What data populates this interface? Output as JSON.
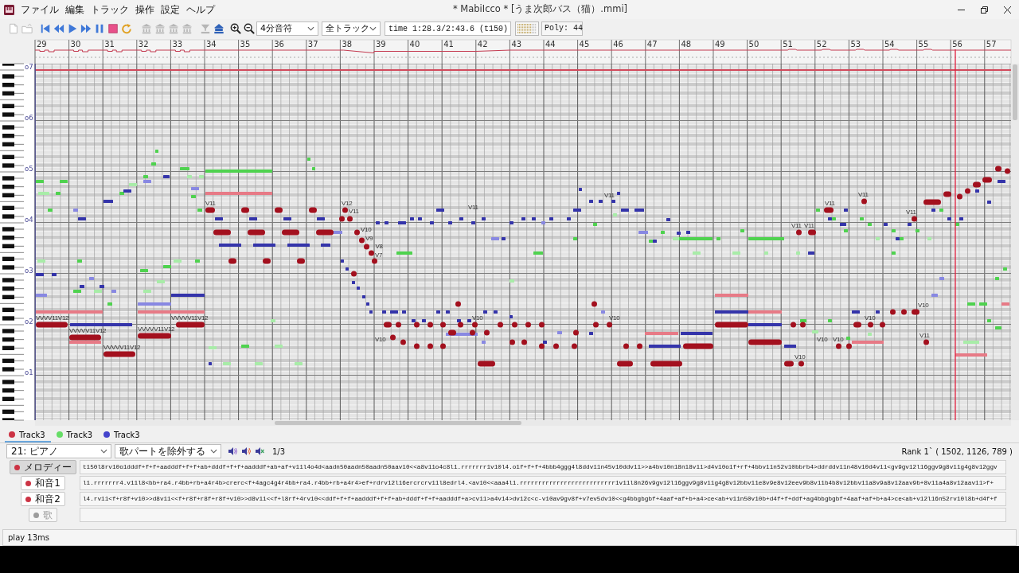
{
  "window": {
    "title": "* MabiIcco *  [うま次郎バス（猫）.mmi]"
  },
  "menu": [
    "ファイル",
    "編集",
    "トラック",
    "操作",
    "設定",
    "ヘルプ"
  ],
  "toolbar": {
    "buttons": [
      {
        "disabled": true
      },
      {
        "disabled": true
      },
      {
        "disabled": false
      },
      {
        "disabled": false
      },
      {
        "disabled": false
      },
      {
        "disabled": false
      },
      {
        "disabled": false
      },
      {
        "disabled": false
      },
      {
        "disabled": false
      },
      {
        "disabled": true
      },
      {
        "disabled": true
      },
      {
        "disabled": true
      },
      {
        "disabled": true
      },
      {
        "disabled": true
      },
      {
        "disabled": false
      },
      {
        "disabled": false
      },
      {
        "disabled": false
      }
    ],
    "note_length": "4分音符",
    "track_filter": "全トラック",
    "time": "time 1:28.3/2:43.6 (t150)",
    "poly": "Poly: 44"
  },
  "piano_roll": {
    "measures": [
      "29",
      "30",
      "31",
      "32",
      "33",
      "34",
      "35",
      "36",
      "37",
      "38",
      "39",
      "40",
      "41",
      "42",
      "43",
      "44",
      "45",
      "46",
      "47",
      "48",
      "49",
      "50",
      "51",
      "52",
      "53",
      "54",
      "55",
      "56",
      "57"
    ],
    "octaves": [
      "o7",
      "o6",
      "o5",
      "o4",
      "o3",
      "o2",
      "o1"
    ],
    "velocity_labels": [
      "VVVV11V12",
      "VVVVV11V12",
      "VVVVV11V12",
      "VVVVV11V12",
      "VVVVV11V12",
      "V11",
      "V12",
      "V11",
      "V10",
      "V9",
      "V8",
      "V7",
      "V11",
      "V10",
      "V10",
      "V10",
      "V11",
      "V11",
      "V11",
      "V11",
      "V11",
      "V11",
      "V10",
      "V10",
      "V11",
      "V10",
      "V10",
      "V10"
    ]
  },
  "tracks": [
    {
      "label": "Track3",
      "color": "#cc3344",
      "selected": true
    },
    {
      "label": "Track3",
      "color": "#66dd66",
      "selected": false
    },
    {
      "label": "Track3",
      "color": "#4444cc",
      "selected": false
    }
  ],
  "track_settings": {
    "instrument": "21: ピアノ",
    "song_part": "歌パートを除外する",
    "page": "1/3",
    "rank": "Rank 1` ( 1502, 1126, 789 )"
  },
  "parts": [
    {
      "label": "メロディー",
      "selected": true,
      "disabled": false,
      "mml": "t150l8rv10o1dddf+f+f+aadddf+f+f+ab+dddf+f+f+aadddf+ab+af+v11l4o4d<aadn50aadn50aadn50aav10<<a8v11o4c8l1.rrrrrrr1v10l4.o1f+f+f+4bbb4ggg4l8ddv11n45v10ddv11>>a4bv10n18n18v11>d4v10o1f+rf+4bbv11n52v10bbrb4>ddrddv11n48v10d4v11<gv9gv12l16ggv9g8v11g4g8v12ggv"
    },
    {
      "label": "和音1",
      "selected": false,
      "disabled": false,
      "mml": "l1.rrrrrrr4.v11l8<bb+ra4.r4bb+rb+a4r4b>crerc<f+4agc4g4r4bb+ra4.r4bb+rb+a4r4>ef+rdrv12l16ercrcrv11l8edrl4.<av10<<aaa4l1.rrrrrrrrrrrrrrrrrrrrrrrrrr1v11l8n26v9gv12l16ggv9g8v11g4g8v12bbv11e8v9e8v12eev9b8v11b4b8v12bbv11a8v9a8v12aav9b+8v11a4a8v12aav11>f+"
    },
    {
      "label": "和音2",
      "selected": false,
      "disabled": false,
      "mml": "l4.rv11<f+r8f+v10>>d8v11<<f+r8f+r8f+r8f+v10>>d8v11<<f+l8rf+4rv10<<ddf+f+f+aadddf+f+f+ab+dddf+f+f+aadddf+a>cv11>a4v14>dv12c<c-v10av9gv8f+v7ev5dv10<<g4bbgbgbf+4aaf+af+b+a4>ce<ab+v11n50v10b+d4f+f+ddf+ag4bbgbgbf+4aaf+af+b+a4>ce<ab+v12l16n52rv10l8b+d4f+f"
    },
    {
      "label": "歌",
      "selected": false,
      "disabled": true
    }
  ],
  "status_bar": "play 13ms"
}
